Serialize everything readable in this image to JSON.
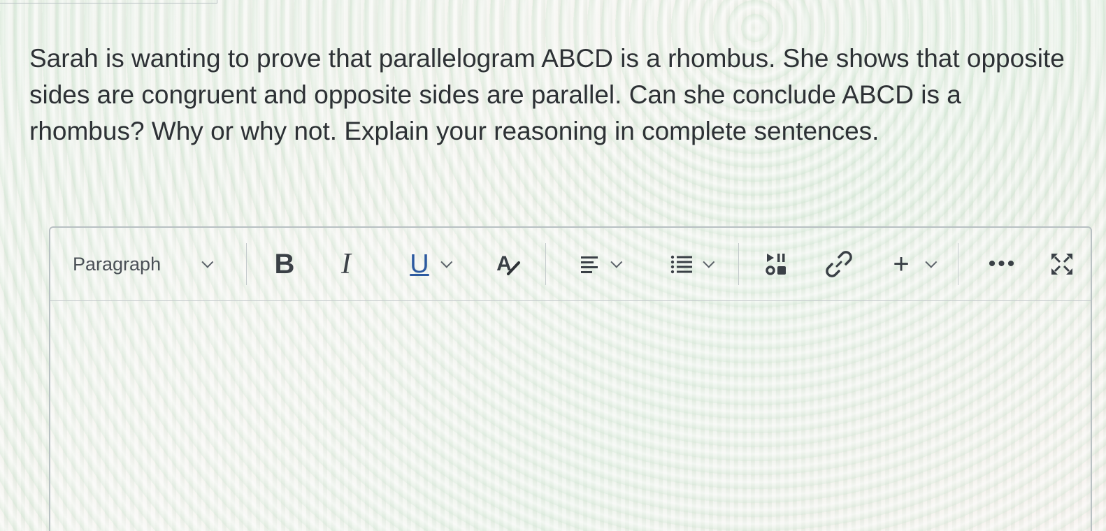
{
  "question": {
    "text": "Sarah is wanting to prove that  parallelogram ABCD is a rhombus.  She shows that opposite sides are congruent and opposite sides are parallel.  Can she conclude ABCD is a rhombus?  Why or why not. Explain your reasoning in complete sentences."
  },
  "toolbar": {
    "block_format": "Paragraph",
    "bold_label": "B",
    "italic_label": "I",
    "underline_label": "U",
    "text_color_label": "A",
    "insert_label": "+",
    "more_label": "•••"
  },
  "icons": {
    "align": "align-left-icon",
    "list": "bullet-list-icon",
    "media": "media-icon",
    "link": "link-icon",
    "fullscreen": "fullscreen-icon"
  },
  "colors": {
    "text": "#2d3135",
    "border": "#b8c0c3",
    "underline_accent": "#2d5aa0"
  }
}
